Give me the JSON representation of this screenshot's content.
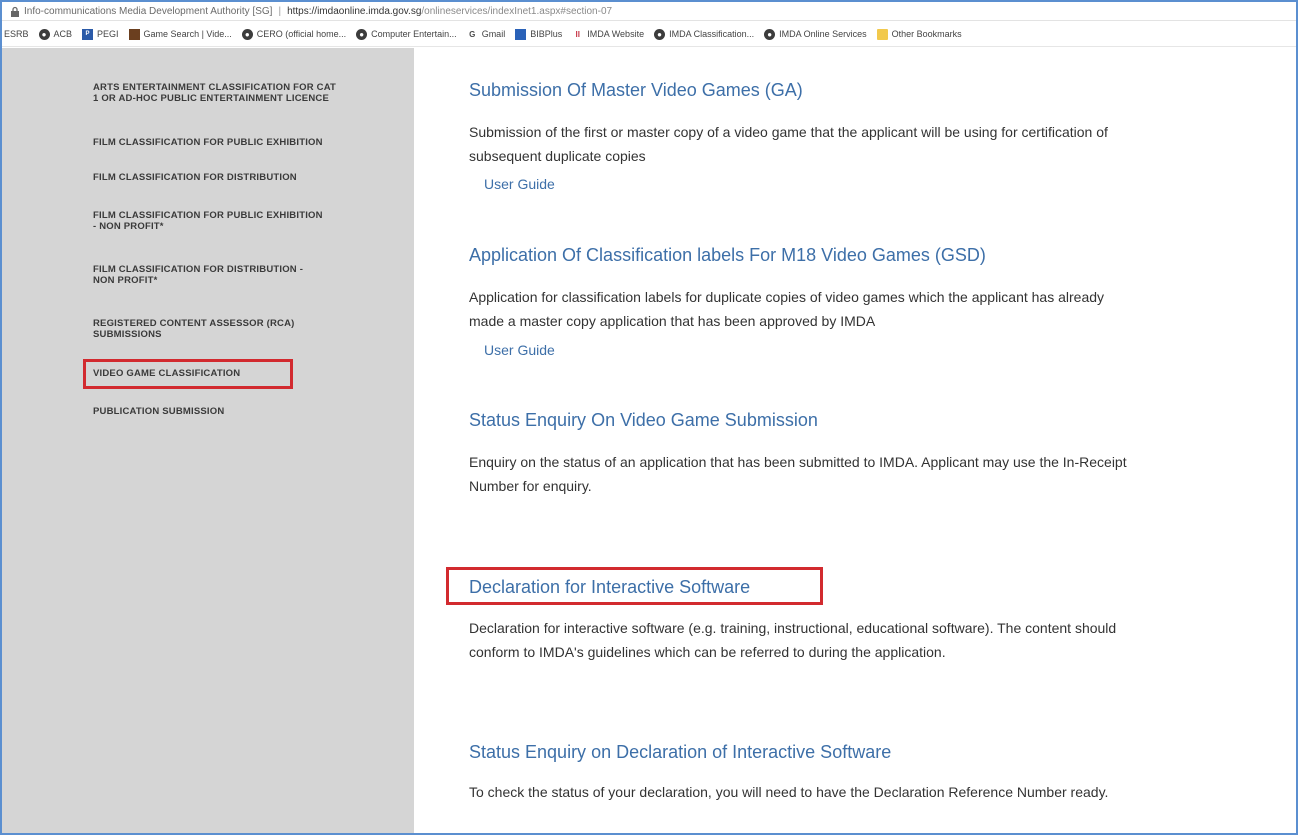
{
  "browser": {
    "site_name": "Info-communications Media Development Authority [SG]",
    "url_domain": "https://imdaonline.imda.gov.sg",
    "url_path": "/onlineservices/indexInet1.aspx#section-07"
  },
  "bookmarks": [
    {
      "label": "ESRB",
      "icon": "none"
    },
    {
      "label": "ACB",
      "icon": "globe-icon"
    },
    {
      "label": "PEGI",
      "icon": "pegi-icon"
    },
    {
      "label": "Game Search | Vide...",
      "icon": "game-icon"
    },
    {
      "label": "CERO (official home...",
      "icon": "globe-icon"
    },
    {
      "label": "Computer Entertain...",
      "icon": "globe-icon"
    },
    {
      "label": "Gmail",
      "icon": "gmail-icon"
    },
    {
      "label": "BIBPlus",
      "icon": "bib-icon"
    },
    {
      "label": "IMDA Website",
      "icon": "imda-icon"
    },
    {
      "label": "IMDA Classification...",
      "icon": "globe-icon"
    },
    {
      "label": "IMDA Online Services",
      "icon": "globe-icon"
    },
    {
      "label": "Other Bookmarks",
      "icon": "folder-icon"
    }
  ],
  "sidebar": {
    "items": [
      {
        "line1": "ARTS ENTERTAINMENT CLASSIFICATION FOR CAT",
        "line2": "1 OR AD-HOC PUBLIC ENTERTAINMENT LICENCE"
      },
      {
        "line1": "FILM CLASSIFICATION FOR PUBLIC EXHIBITION",
        "line2": ""
      },
      {
        "line1": "FILM CLASSIFICATION FOR DISTRIBUTION",
        "line2": ""
      },
      {
        "line1": "FILM CLASSIFICATION FOR PUBLIC EXHIBITION",
        "line2": "- NON PROFIT*"
      },
      {
        "line1": "FILM CLASSIFICATION FOR DISTRIBUTION -",
        "line2": "NON PROFIT*"
      },
      {
        "line1": "REGISTERED CONTENT ASSESSOR (RCA)",
        "line2": "SUBMISSIONS"
      },
      {
        "line1": "VIDEO GAME CLASSIFICATION",
        "line2": ""
      },
      {
        "line1": "PUBLICATION SUBMISSION",
        "line2": ""
      }
    ]
  },
  "sections": [
    {
      "title": "Submission Of Master Video Games (GA)",
      "desc_line1": "Submission of the first or master copy of a video game that the applicant will be using for certification of",
      "desc_line2": "subsequent duplicate copies",
      "link": "User Guide"
    },
    {
      "title": "Application Of Classification labels For M18 Video Games (GSD)",
      "desc_line1": "Application for classification labels for duplicate copies of video games which the applicant has already",
      "desc_line2": "made a master copy application that has been approved by IMDA",
      "link": "User Guide"
    },
    {
      "title": "Status Enquiry On Video Game Submission",
      "desc_line1": "Enquiry on the status of an application that has been submitted to IMDA. Applicant may use the In-Receipt",
      "desc_line2": "Number for enquiry."
    },
    {
      "title": "Declaration for Interactive Software",
      "desc_line1": "Declaration for interactive software (e.g. training, instructional, educational software). The content should",
      "desc_line2": "conform to IMDA's guidelines which can be referred to during the application."
    },
    {
      "title": "Status Enquiry on Declaration of Interactive Software",
      "desc_line1": "To check the status of your declaration, you will need to have the Declaration Reference Number ready."
    }
  ],
  "highlight_color": "#d22a2f",
  "link_color": "#3d6fa8"
}
